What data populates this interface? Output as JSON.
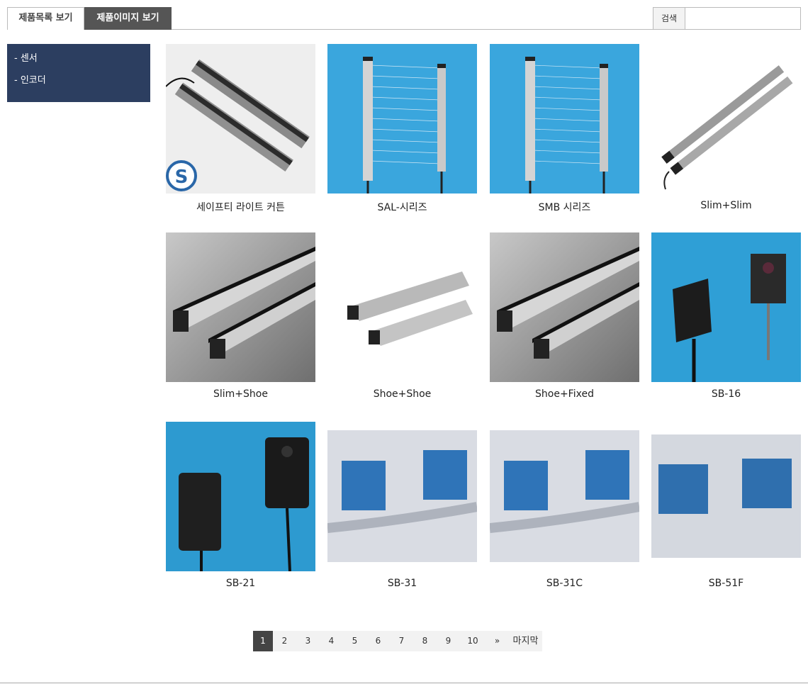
{
  "tabs": {
    "list_label": "제품목록 보기",
    "image_label": "제품이미지 보기"
  },
  "search": {
    "button_label": "검색",
    "placeholder": ""
  },
  "sidebar": {
    "items": [
      {
        "label": "- 센서"
      },
      {
        "label": "- 인코더"
      }
    ]
  },
  "products": [
    {
      "name": "세이프티 라이트 커튼"
    },
    {
      "name": "SAL-시리즈"
    },
    {
      "name": "SMB 시리즈"
    },
    {
      "name": "Slim+Slim"
    },
    {
      "name": "Slim+Shoe"
    },
    {
      "name": "Shoe+Shoe"
    },
    {
      "name": "Shoe+Fixed"
    },
    {
      "name": "SB-16"
    },
    {
      "name": "SB-21"
    },
    {
      "name": "SB-31"
    },
    {
      "name": "SB-31C"
    },
    {
      "name": "SB-51F"
    }
  ],
  "pagination": {
    "pages": [
      "1",
      "2",
      "3",
      "4",
      "5",
      "6",
      "7",
      "8",
      "9",
      "10"
    ],
    "current": "1",
    "next_label": "»",
    "last_label": "마지막"
  },
  "colors": {
    "sidebar_bg": "#2c3e60",
    "active_tab_bg": "#555555",
    "active_page_bg": "#444444"
  }
}
